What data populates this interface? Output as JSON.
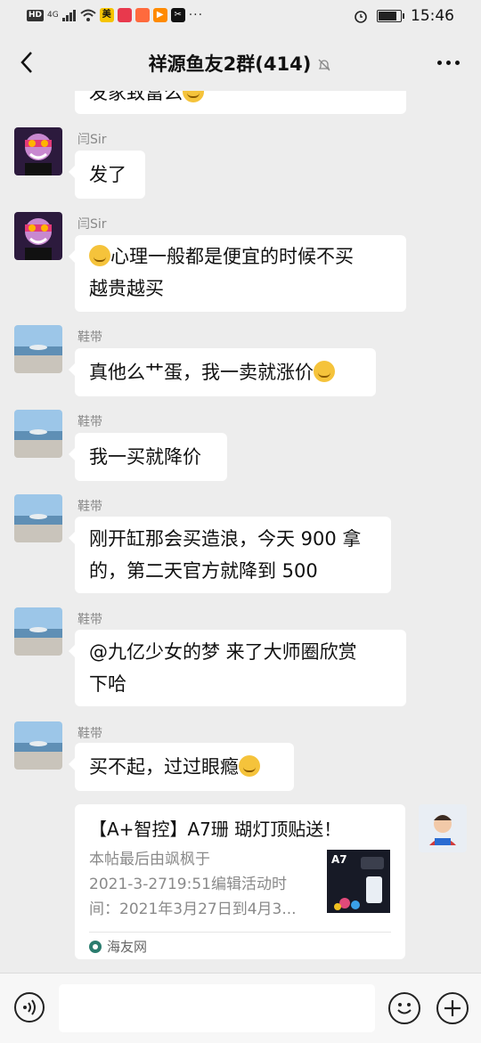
{
  "status_bar": {
    "left_badges": [
      "HD",
      "4G"
    ],
    "time": "15:46",
    "battery_level": 0.8,
    "app_icons": [
      "美",
      "",
      "",
      "",
      ""
    ],
    "app_colors": [
      "#f5c400",
      "#e8394d",
      "#ff6a3d",
      "#ff8a00",
      "#111111"
    ]
  },
  "header": {
    "title": "祥源鱼友2群(414)",
    "back_icon": "chevron-left-icon",
    "mute_icon": "bell-off-icon",
    "more_icon": "more-dots-icon"
  },
  "messages": [
    {
      "sender": "",
      "text": "发家致富么",
      "emoji": true
    },
    {
      "sender": "闫Sir",
      "text": "发了",
      "emoji": false
    },
    {
      "sender": "闫Sir",
      "text_line1": "心理一般都是便宜的时候不买",
      "text_line2": "越贵越买",
      "emoji_before": true
    },
    {
      "sender": "鞋带",
      "text": "真他么艹蛋，我一卖就涨价",
      "emoji": true
    },
    {
      "sender": "鞋带",
      "text": "我一买就降价",
      "emoji": false
    },
    {
      "sender": "鞋带",
      "text_line1": "刚开缸那会买造浪，今天 900 拿",
      "text_line2": "的，第二天官方就降到 500"
    },
    {
      "sender": "鞋带",
      "text_line1": "@九亿少女的梦  来了大师圈欣赏",
      "text_line2": "下哈"
    },
    {
      "sender": "鞋带",
      "text": "买不起，过过眼瘾",
      "emoji": true
    }
  ],
  "link_card": {
    "title": "【A+智控】A7珊 瑚灯顶贴送！",
    "desc_line1": "本帖最后由飒枫于",
    "desc_line2": "2021-3-2719:51编辑活动时",
    "desc_line3": "间：2021年3月27日到4月3...",
    "thumb_text": "A7",
    "source": "海友网"
  },
  "input_bar": {
    "voice_icon": "voice-icon",
    "emoji_icon": "emoji-icon",
    "plus_icon": "plus-icon"
  }
}
